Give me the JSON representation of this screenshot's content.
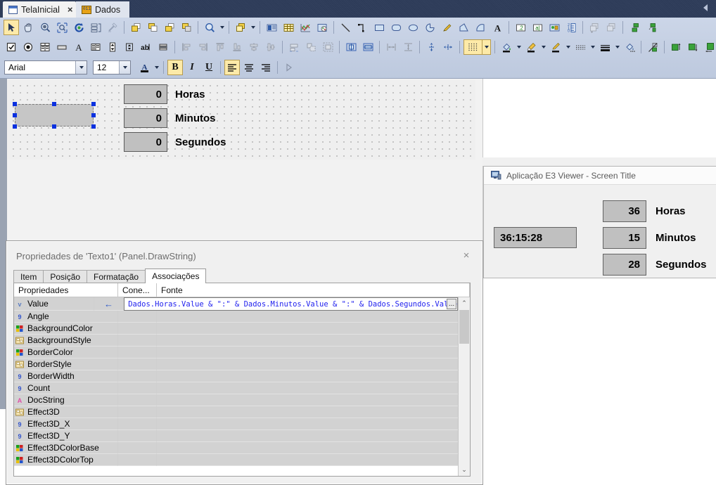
{
  "window": {
    "tabs": [
      {
        "label": "TelaInicial",
        "icon": "screen-document-icon",
        "active": true,
        "closable": true,
        "close_label": "×"
      },
      {
        "label": "Dados",
        "icon": "database-icon",
        "active": false,
        "closable": false
      }
    ],
    "collapse_icon": "collapse-left-arrow-icon"
  },
  "toolbars": {
    "row1": [
      {
        "name": "select-arrow-tool",
        "type": "button",
        "selected": true
      },
      {
        "name": "pan-hand-tool",
        "type": "button"
      },
      {
        "name": "zoom-tool",
        "type": "button"
      },
      {
        "name": "zoom-region-tool",
        "type": "button"
      },
      {
        "name": "refresh-tool",
        "type": "button"
      },
      {
        "name": "list-properties-tool",
        "type": "button"
      },
      {
        "name": "eyedropper-tool",
        "type": "button",
        "disabled": true
      },
      {
        "name": "separator",
        "type": "separator"
      },
      {
        "name": "bring-to-front-tool",
        "type": "button"
      },
      {
        "name": "send-to-back-tool",
        "type": "button"
      },
      {
        "name": "bring-forward-tool",
        "type": "button"
      },
      {
        "name": "send-backward-tool",
        "type": "button"
      },
      {
        "name": "separator",
        "type": "separator"
      },
      {
        "name": "zoom-level-tool",
        "type": "button",
        "dropdown": true
      },
      {
        "name": "separator",
        "type": "separator"
      },
      {
        "name": "group-tool",
        "type": "button",
        "dropdown": true
      },
      {
        "name": "separator",
        "type": "separator"
      },
      {
        "name": "insert-display-tool",
        "type": "button"
      },
      {
        "name": "insert-grid-tool",
        "type": "button"
      },
      {
        "name": "insert-chart-tool",
        "type": "button"
      },
      {
        "name": "insert-image-tool",
        "type": "button"
      },
      {
        "name": "separator",
        "type": "separator"
      },
      {
        "name": "draw-line-tool",
        "type": "button"
      },
      {
        "name": "draw-polyline-tool",
        "type": "button"
      },
      {
        "name": "draw-rectangle-tool",
        "type": "button"
      },
      {
        "name": "draw-rounded-rectangle-tool",
        "type": "button"
      },
      {
        "name": "draw-ellipse-tool",
        "type": "button"
      },
      {
        "name": "draw-pie-tool",
        "type": "button"
      },
      {
        "name": "draw-pencil-tool",
        "type": "button"
      },
      {
        "name": "draw-polygon-tool",
        "type": "button"
      },
      {
        "name": "draw-arc-tool",
        "type": "button"
      },
      {
        "name": "insert-text-tool",
        "type": "button"
      },
      {
        "name": "separator",
        "type": "separator"
      },
      {
        "name": "insert-numeric-tool",
        "type": "button"
      },
      {
        "name": "insert-alpha-tool",
        "type": "button"
      },
      {
        "name": "insert-object-tool",
        "type": "button"
      },
      {
        "name": "insert-scale-tool",
        "type": "button"
      },
      {
        "name": "separator",
        "type": "separator"
      },
      {
        "name": "copy-style-tool",
        "type": "button",
        "disabled": true
      },
      {
        "name": "paste-style-tool",
        "type": "button",
        "disabled": true
      },
      {
        "name": "separator",
        "type": "separator"
      },
      {
        "name": "link-object-tool",
        "type": "button"
      },
      {
        "name": "unlink-object-tool",
        "type": "button"
      }
    ],
    "row2": [
      {
        "name": "checkbox-control-tool",
        "type": "button"
      },
      {
        "name": "radiobutton-control-tool",
        "type": "button"
      },
      {
        "name": "listbox-control-tool",
        "type": "button"
      },
      {
        "name": "button-control-tool",
        "type": "button"
      },
      {
        "name": "label-control-tool",
        "type": "button"
      },
      {
        "name": "combobox-control-tool",
        "type": "button"
      },
      {
        "name": "spinner-control-tool",
        "type": "button"
      },
      {
        "name": "updown-control-tool",
        "type": "button"
      },
      {
        "name": "textbox-control-tool",
        "type": "button"
      },
      {
        "name": "splitter-control-tool",
        "type": "button"
      },
      {
        "name": "separator",
        "type": "separator"
      },
      {
        "name": "align-left-tool",
        "type": "button",
        "disabled": true
      },
      {
        "name": "align-right-tool",
        "type": "button",
        "disabled": true
      },
      {
        "name": "align-top-tool",
        "type": "button",
        "disabled": true
      },
      {
        "name": "align-bottom-tool",
        "type": "button",
        "disabled": true
      },
      {
        "name": "align-center-horizontal-tool",
        "type": "button",
        "disabled": true
      },
      {
        "name": "align-center-vertical-tool",
        "type": "button",
        "disabled": true
      },
      {
        "name": "separator",
        "type": "separator"
      },
      {
        "name": "make-same-width-tool",
        "type": "button",
        "disabled": true
      },
      {
        "name": "make-same-size-tool",
        "type": "button",
        "disabled": true
      },
      {
        "name": "make-same-height-tool",
        "type": "button",
        "disabled": true
      },
      {
        "name": "separator",
        "type": "separator"
      },
      {
        "name": "center-horizontally-tool",
        "type": "button"
      },
      {
        "name": "center-vertically-tool",
        "type": "button"
      },
      {
        "name": "separator",
        "type": "separator"
      },
      {
        "name": "space-horizontally-tool",
        "type": "button",
        "disabled": true
      },
      {
        "name": "space-vertically-tool",
        "type": "button",
        "disabled": true
      },
      {
        "name": "separator",
        "type": "separator"
      },
      {
        "name": "distribute-horizontal-tool",
        "type": "button",
        "disabled": true
      },
      {
        "name": "distribute-vertical-tool",
        "type": "button",
        "disabled": true
      },
      {
        "name": "separator",
        "type": "separator"
      },
      {
        "name": "snap-to-grid-tool",
        "type": "button",
        "selected": true,
        "dropdown": true
      },
      {
        "name": "separator",
        "type": "separator"
      },
      {
        "name": "fill-color-tool",
        "type": "button",
        "dropdown": true
      },
      {
        "name": "brush-style-tool",
        "type": "button",
        "dropdown": true
      },
      {
        "name": "line-color-tool",
        "type": "button",
        "dropdown": true
      },
      {
        "name": "line-style-tool",
        "type": "button",
        "dropdown": true
      },
      {
        "name": "line-weight-tool",
        "type": "button",
        "dropdown": true
      },
      {
        "name": "gradient-tool",
        "type": "button"
      },
      {
        "name": "separator",
        "type": "separator"
      },
      {
        "name": "transparency-tool",
        "type": "button"
      },
      {
        "name": "separator",
        "type": "separator"
      },
      {
        "name": "raise-object-tool",
        "type": "button"
      },
      {
        "name": "lower-object-tool",
        "type": "button"
      },
      {
        "name": "shift-left-tool",
        "type": "button"
      },
      {
        "name": "shift-right-tool",
        "type": "button"
      },
      {
        "name": "separator",
        "type": "separator"
      },
      {
        "name": "object-color-tool",
        "type": "button",
        "dropdown": true
      }
    ],
    "fontbar": {
      "font_family_value": "Arial",
      "font_size_value": "12",
      "font_color_icon": "font-color-icon",
      "bold_label": "B",
      "italic_label": "I",
      "underline_label": "U",
      "align_left_icon": "align-left-icon",
      "align_center_icon": "align-center-icon",
      "align_right_icon": "align-right-icon",
      "overflow_icon": "toolbar-overflow-icon",
      "bold_active": true,
      "align_left_active": true
    }
  },
  "canvas": {
    "selected_object_name": "selected-text-object",
    "fields": [
      {
        "value": "0",
        "label": "Horas"
      },
      {
        "value": "0",
        "label": "Minutos"
      },
      {
        "value": "0",
        "label": "Segundos"
      }
    ]
  },
  "dialog": {
    "title": "Propriedades de 'Texto1' (Panel.DrawString)",
    "close_label": "×",
    "tabs": [
      {
        "label": "Item",
        "active": false
      },
      {
        "label": "Posição",
        "active": false
      },
      {
        "label": "Formatação",
        "active": false
      },
      {
        "label": "Associações",
        "active": true
      }
    ],
    "grid": {
      "columns": [
        "Propriedades",
        "Cone...",
        "Fonte"
      ],
      "rows": [
        {
          "icon": "value-property-icon",
          "icon_kind": "v",
          "name": "Value",
          "conn": "←",
          "font": "Dados.Horas.Value & \":\" & Dados.Minutos.Value & \":\" & Dados.Segundos.Value",
          "selected": true,
          "ellipsis_label": "..."
        },
        {
          "icon": "number-property-icon",
          "icon_kind": "num",
          "name": "Angle",
          "conn": "",
          "font": ""
        },
        {
          "icon": "color-property-icon",
          "icon_kind": "color",
          "name": "BackgroundColor",
          "conn": "",
          "font": ""
        },
        {
          "icon": "enum-property-icon",
          "icon_kind": "enum",
          "name": "BackgroundStyle",
          "conn": "",
          "font": ""
        },
        {
          "icon": "color-property-icon",
          "icon_kind": "color",
          "name": "BorderColor",
          "conn": "",
          "font": ""
        },
        {
          "icon": "enum-property-icon",
          "icon_kind": "enum",
          "name": "BorderStyle",
          "conn": "",
          "font": ""
        },
        {
          "icon": "number-property-icon",
          "icon_kind": "num",
          "name": "BorderWidth",
          "conn": "",
          "font": ""
        },
        {
          "icon": "number-property-icon",
          "icon_kind": "num",
          "name": "Count",
          "conn": "",
          "font": ""
        },
        {
          "icon": "string-property-icon",
          "icon_kind": "str",
          "name": "DocString",
          "conn": "",
          "font": ""
        },
        {
          "icon": "enum-property-icon",
          "icon_kind": "enum",
          "name": "Effect3D",
          "conn": "",
          "font": ""
        },
        {
          "icon": "number-property-icon",
          "icon_kind": "num",
          "name": "Effect3D_X",
          "conn": "",
          "font": ""
        },
        {
          "icon": "number-property-icon",
          "icon_kind": "num",
          "name": "Effect3D_Y",
          "conn": "",
          "font": ""
        },
        {
          "icon": "color-property-icon",
          "icon_kind": "color",
          "name": "Effect3DColorBase",
          "conn": "",
          "font": ""
        },
        {
          "icon": "color-property-icon",
          "icon_kind": "color",
          "name": "Effect3DColorTop",
          "conn": "",
          "font": ""
        }
      ],
      "scroll_up_label": "⌃",
      "scroll_down_label": "⌄"
    }
  },
  "viewer": {
    "title": "Aplicação E3 Viewer - Screen Title",
    "icon": "e3-viewer-icon",
    "time_string": "36:15:28",
    "fields": [
      {
        "value": "36",
        "label": "Horas"
      },
      {
        "value": "15",
        "label": "Minutos"
      },
      {
        "value": "28",
        "label": "Segundos"
      }
    ]
  },
  "colors": {
    "tabstrip_bg": "#2e3c59",
    "toolbar_bg": "#c6d1e3",
    "selection_handle": "#0b31e0",
    "formula_text": "#2222ee",
    "highlight_yellow": "#fdeaa8"
  }
}
